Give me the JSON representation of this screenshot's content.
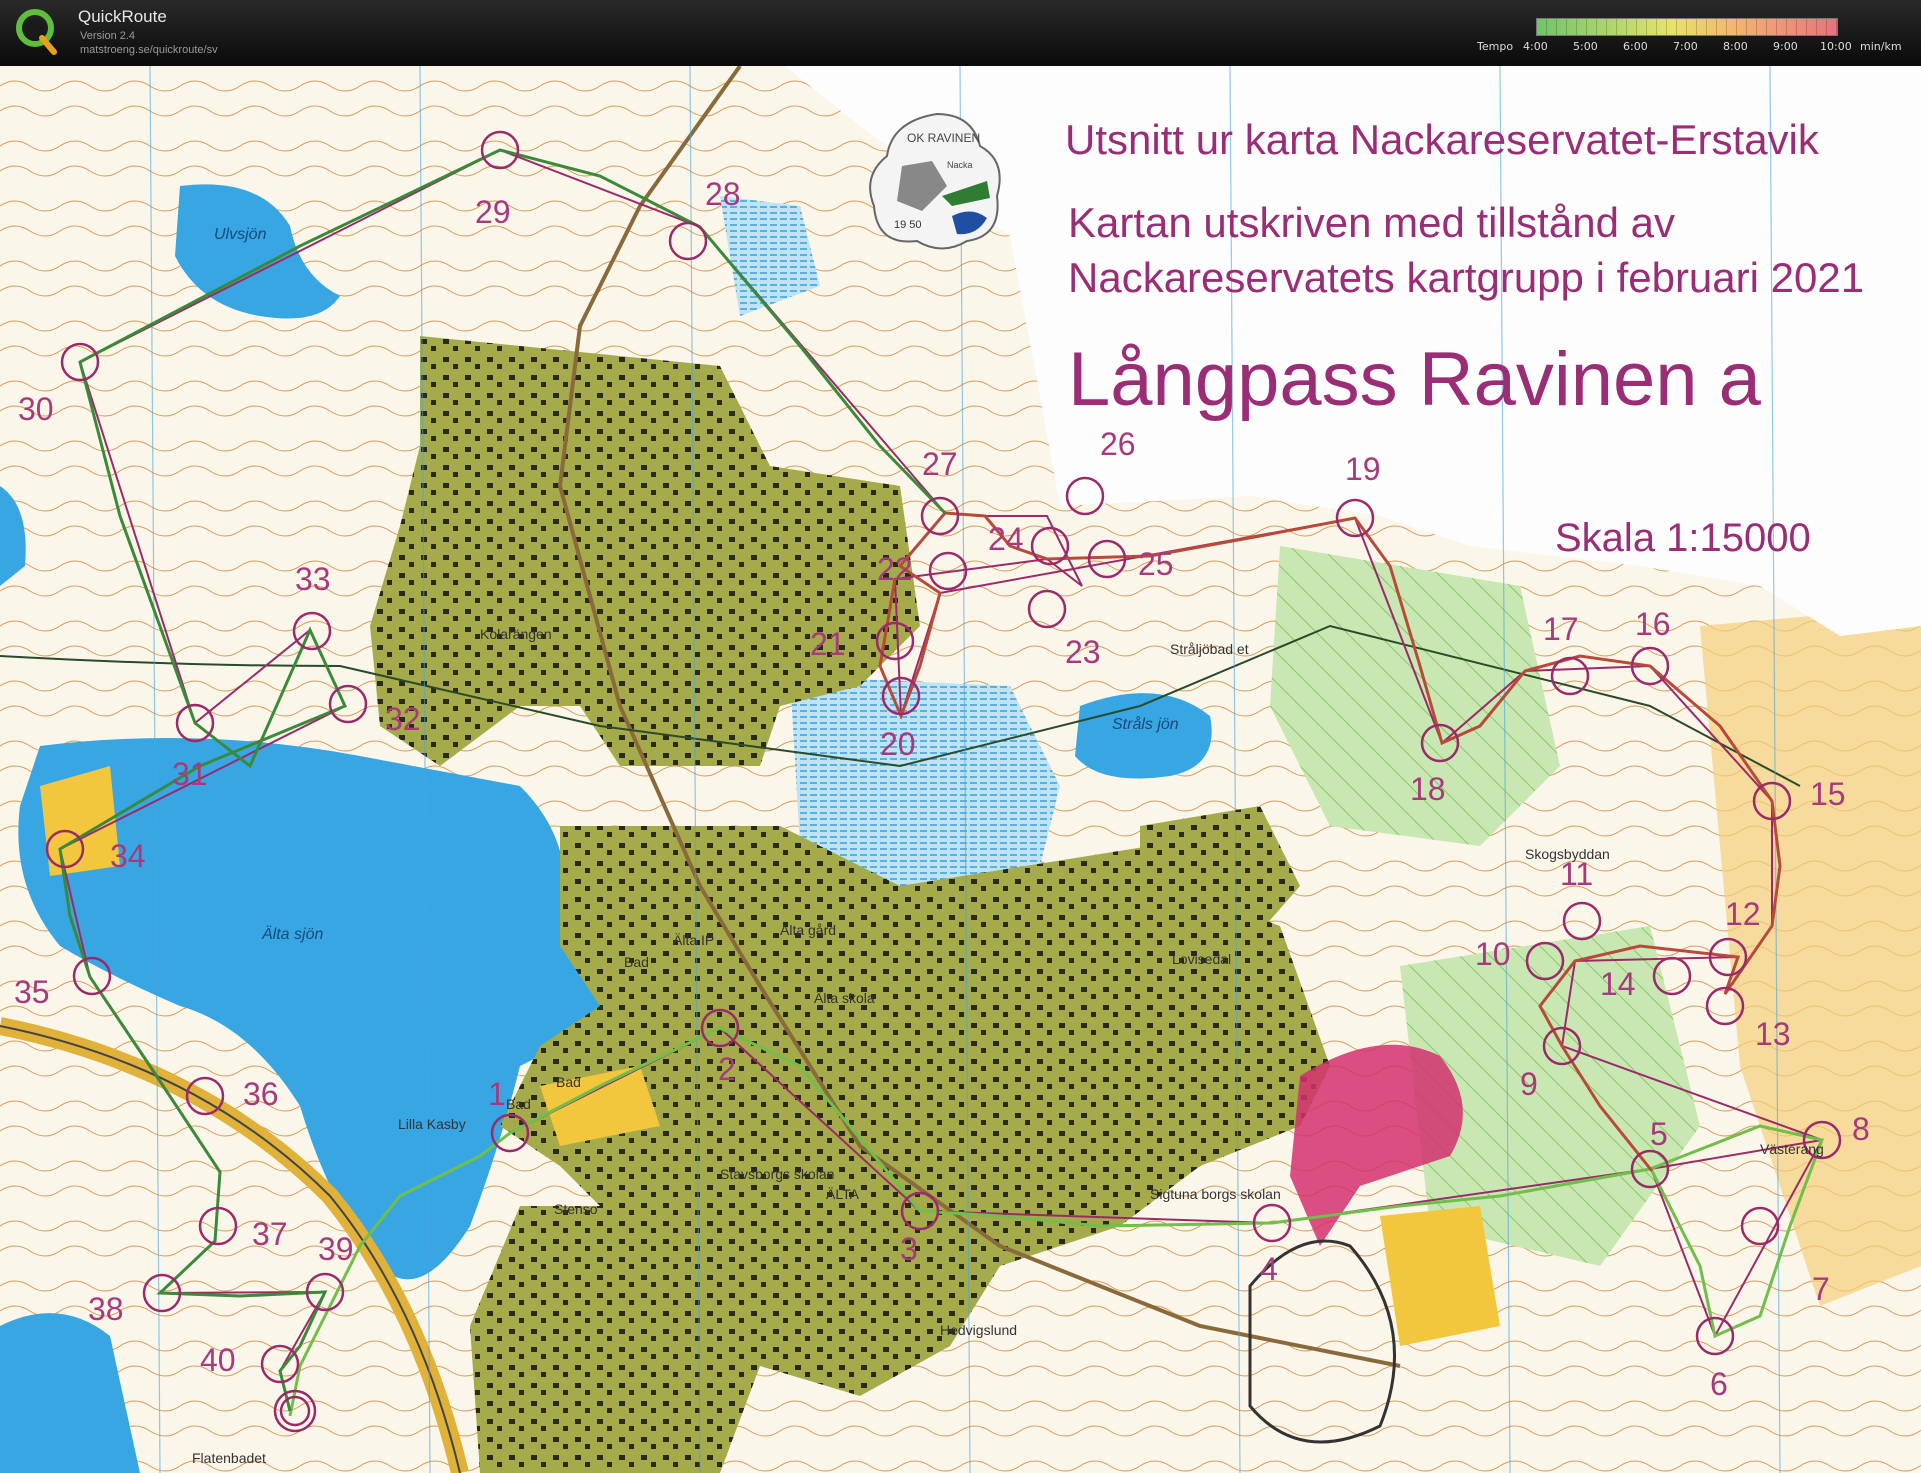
{
  "app": {
    "title": "QuickRoute",
    "version": "Version 2.4",
    "url": "matstroeng.se/quickroute/sv"
  },
  "tempo": {
    "label": "Tempo",
    "ticks": [
      "4:00",
      "5:00",
      "6:00",
      "7:00",
      "8:00",
      "9:00",
      "10:00"
    ],
    "unit": "min/km"
  },
  "map": {
    "header_line1": "Utsnitt ur karta Nackareservatet-Erstavik",
    "header_line2": "Kartan utskriven med tillstånd av",
    "header_line3": "Nackareservatets kartgrupp i februari 2021",
    "title": "Långpass Ravinen a",
    "scale": "Skala 1:15000",
    "club_logo": {
      "name": "OK RAVINEN",
      "place": "Nacka",
      "year": "19 50"
    },
    "controls": [
      "1",
      "2",
      "3",
      "4",
      "5",
      "6",
      "7",
      "8",
      "9",
      "10",
      "11",
      "12",
      "13",
      "14",
      "15",
      "16",
      "17",
      "18",
      "19",
      "20",
      "21",
      "22",
      "23",
      "24",
      "25",
      "26",
      "27",
      "28",
      "29",
      "30",
      "31",
      "32",
      "33",
      "34",
      "35",
      "36",
      "37",
      "38",
      "39",
      "40"
    ],
    "place_names": [
      "Ulvsjön",
      "Kolarängen",
      "Stråljöbad et",
      "Stråls jön",
      "Älta gård",
      "Älta IP",
      "Älta skola",
      "Älta sjön",
      "Bad",
      "Bad",
      "Bad",
      "Lilla Kasby",
      "Stavsborgs skolan",
      "Stenso",
      "ÄLTA",
      "Sigtuna borgs skolan",
      "Hedvigslund",
      "Lovisedal",
      "Skogsbyddan",
      "Västerang",
      "Flatenbadet"
    ]
  },
  "colors": {
    "route_line": "#9b2a6a",
    "water": "#38a7e4",
    "settlement": "#a7ab4a",
    "open_land": "#f3c640",
    "tempo_slow": "#e8727e",
    "tempo_fast": "#6fc46b"
  }
}
